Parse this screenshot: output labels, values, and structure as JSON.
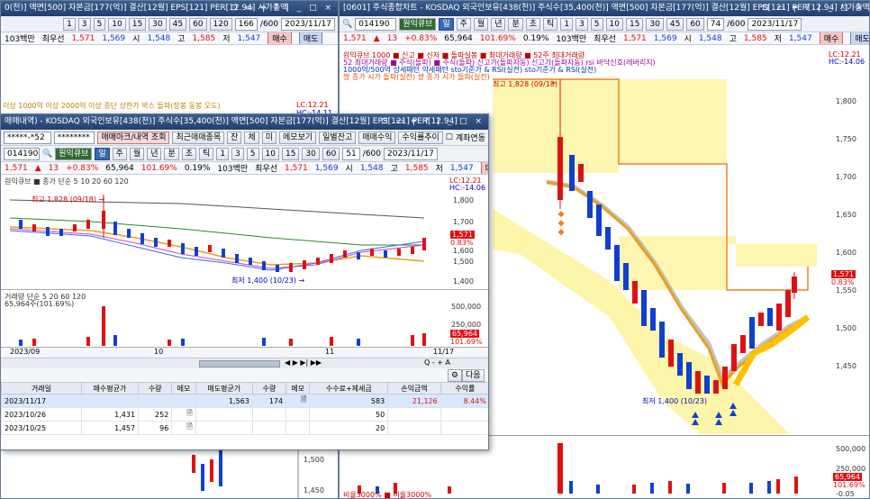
{
  "left_window": {
    "title": "0(천)] 액면[500] 자본금[177(억)] 결산[12월] EPS[121] PER[12.94] 시가총액",
    "count": "166",
    "total": "/600",
    "date": "2023/11/17",
    "price_row": {
      "vol_label": "103백만",
      "wu": "최우선",
      "p1": "1,571",
      "p2": "1,569",
      "si_label": "시",
      "si": "1,548",
      "go_label": "고",
      "go": "1,585",
      "jeo_label": "저",
      "jeo": "1,547",
      "buy": "매수",
      "sell": "매도"
    },
    "legend": "이상 1000억 이상 2000억 이상 종단 상한가   박스 돌파(장봉 동봉 오도)",
    "lc": "LC:12.21",
    "hc": "HC:-14.11",
    "axis": [
      "1,500",
      "1,450"
    ]
  },
  "right_window": {
    "title": "[0601] 주식종합차트 - KOSDAQ 외국인보유[438(천)] 주식수[35,400(천)] 액면[500] 자본금[177(억)] 결산[12월] EPS[121] PER[12.94] 시가총액",
    "code": "014190",
    "name": "원익큐브",
    "periods": [
      "일",
      "주",
      "월",
      "년",
      "분",
      "초",
      "틱",
      "1",
      "3",
      "5",
      "10",
      "15",
      "30",
      "45",
      "60",
      "5"
    ],
    "count": "74",
    "total": "/600",
    "date": "2023/11/17",
    "price_row": {
      "price": "1,571",
      "arrow": "▲",
      "change": "13",
      "pct": "+0.83%",
      "volume": "65,964",
      "vol_pct": "101.69%",
      "rate": "0.19%",
      "vol_label": "103백만",
      "wu": "최우선",
      "p1": "1,571",
      "p2": "1,569",
      "si_label": "시",
      "si": "1,548",
      "go_label": "고",
      "go": "1,585",
      "jeo_label": "저",
      "jeo": "1,547",
      "buy": "매수",
      "sell": "매도"
    },
    "legend_lines": [
      "원익큐브 1000   ■ 신고   ■ 신저   ■ 돌파실봉   ■ 최대거래량   ■ 52주 최대거래량",
      "52 최대거래량 ■ 주식(돌파) ■ 주식(돌파)  신고가(돌파자동) 신고가(돌파자동)  rsi 바닥신호(레버리지)",
      "1000억/500억 상세패턴 약세패턴  sto기준가 & RSI(실전)  sto기준가 & RSI(실전)",
      "쌍 종가 시가 돌파(실전)  쌍 종가 시가 돌파(실전)"
    ],
    "lc": "LC:12.21",
    "hc": "HC:-14.06",
    "y_axis": [
      "1,800",
      "1,750",
      "1,700",
      "1,650",
      "1,600",
      "1,550",
      "1,500",
      "1,450"
    ],
    "price_tag": "1,571",
    "price_tag_pct": "0.83%",
    "high_note": "최고 1,828 (09/18)",
    "low_note": "최저 1,400 (10/23)",
    "vol_axis": [
      "500,000",
      "250,000"
    ],
    "vol_tag": "65,964",
    "vol_tag_pct": "101.69%",
    "vol_legend": "비율3000% ■ 비율3000%",
    "vol_bottom": "-0.05"
  },
  "front_window": {
    "title": "매매내역) - KOSDAQ 외국인보유[438(천)] 주식수[35,400(천)] 액면[500] 자본금[177(억)] 결산[12월] EPS[121] PER[12.94]",
    "account": "*****-*52",
    "password": "********",
    "btn_trade": "매매마크/내역 조회",
    "btn_recent": "최근매매종목",
    "btn_jan": "잔",
    "btn_che": "체",
    "btn_mi": "미",
    "btn_memo": "메모보기",
    "btn_daily": "일별잔고",
    "btn_profit": "매매수익",
    "btn_trend": "수익률추이",
    "chk_account": "계좌연동",
    "code": "014190",
    "name": "원익큐브",
    "count": "51",
    "total": "/600",
    "date": "2023/11/17",
    "price_row": {
      "price": "1,571",
      "arrow": "▲",
      "change": "13",
      "pct": "+0.83%",
      "volume": "65,964",
      "vol_pct": "101.69%",
      "rate": "0.19%",
      "vol_label": "103백만",
      "wu": "최우선",
      "p1": "1,571",
      "p2": "1,569",
      "si_label": "시",
      "si": "1,548",
      "go_label": "고",
      "go": "1,585",
      "jeo_label": "저",
      "jeo": "1,547",
      "buy": "매수",
      "sell": "매도"
    },
    "legend": "원익큐브 ■ 종가 단순 5 10 20 60 120",
    "lc": "LC:12.21",
    "hc": "HC:-14.06",
    "y_axis": [
      "1,800",
      "1,700",
      "1,600",
      "1,500",
      "1,400"
    ],
    "price_tag": "1,571",
    "price_tag_pct": "0.83%",
    "high_note": "최고 1,828 (09/18) →",
    "low_note": "최저 1,400 (10/23) →",
    "vol_legend": "거래량 단순 5 20 60 120",
    "vol_value": "65,964주(101.69%)",
    "vol_axis": [
      "500,000",
      "250,000"
    ],
    "vol_tag": "65,964",
    "vol_tag_pct": "101.69%",
    "x_labels": [
      "2023/09",
      "10",
      "11",
      "11/17"
    ],
    "next_btn": "다음",
    "table": {
      "headers": [
        "거래일",
        "매수평균가",
        "수량",
        "메모",
        "매도평균가",
        "수량",
        "메모",
        "수수료+제세금",
        "손익금액",
        "수익률"
      ],
      "rows": [
        [
          "2023/11/17",
          "",
          "",
          "",
          "1,563",
          "174",
          "",
          "583",
          "21,126",
          "8.44%"
        ],
        [
          "2023/10/26",
          "1,431",
          "252",
          "",
          "",
          "",
          "",
          "50",
          "",
          ""
        ],
        [
          "2023/10/25",
          "1,457",
          "96",
          "",
          "",
          "",
          "",
          "20",
          "",
          ""
        ]
      ]
    }
  }
}
